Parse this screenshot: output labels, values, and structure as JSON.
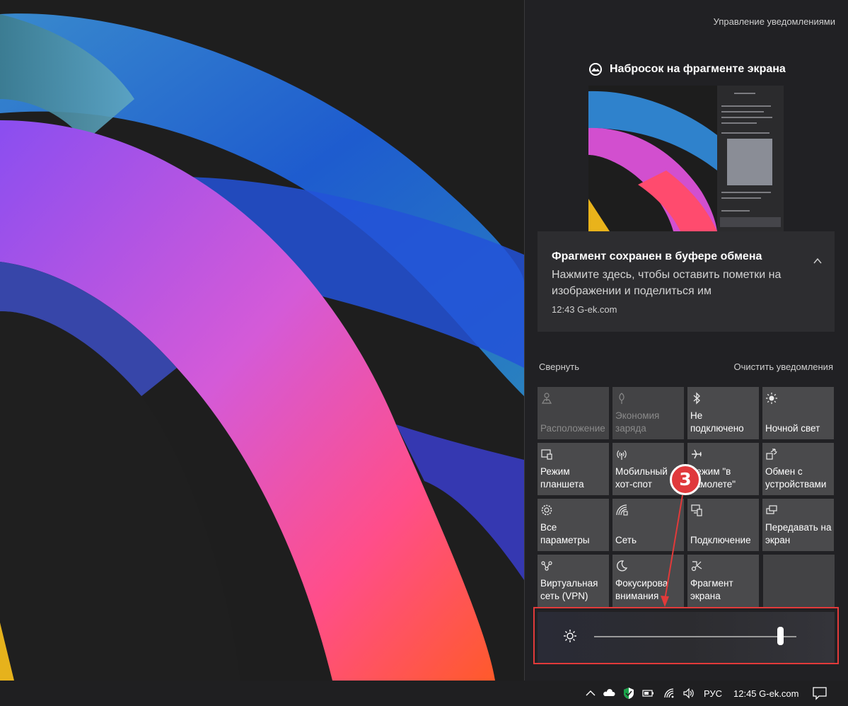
{
  "action_center": {
    "manage_link": "Управление уведомлениями",
    "app_name": "Набросок на фрагменте экрана",
    "notification": {
      "title": "Фрагмент сохранен в буфере обмена",
      "body": "Нажмите здесь, чтобы оставить пометки на изображении и поделиться им",
      "meta": "12:43 G-ek.com"
    },
    "collapse_link": "Свернуть",
    "clear_link": "Очистить уведомления",
    "tiles": [
      {
        "label": "Расположение",
        "icon": "location-icon",
        "dim": true
      },
      {
        "label": "Экономия\nзаряда",
        "icon": "battery-saver-icon",
        "dim": true
      },
      {
        "label": "Не\nподключено",
        "icon": "bluetooth-icon",
        "dim": false
      },
      {
        "label": "Ночной свет",
        "icon": "night-light-icon",
        "dim": false
      },
      {
        "label": "Режим\nпланшета",
        "icon": "tablet-mode-icon",
        "dim": false
      },
      {
        "label": "Мобильный\nхот-спот",
        "icon": "hotspot-icon",
        "dim": false
      },
      {
        "label": "Режим \"в\nсамолете\"",
        "icon": "airplane-icon",
        "dim": false
      },
      {
        "label": "Обмен с\nустройствами",
        "icon": "nearby-share-icon",
        "dim": false
      },
      {
        "label": "Все параметры",
        "icon": "settings-icon",
        "dim": false
      },
      {
        "label": "Сеть",
        "icon": "network-icon",
        "dim": false
      },
      {
        "label": "Подключение",
        "icon": "connect-icon",
        "dim": false
      },
      {
        "label": "Передавать на\nэкран",
        "icon": "project-icon",
        "dim": false
      },
      {
        "label": "Виртуальная\nсеть (VPN)",
        "icon": "vpn-icon",
        "dim": false
      },
      {
        "label": "Фокусирова\nвнимания",
        "icon": "focus-assist-icon",
        "dim": false
      },
      {
        "label": "Фрагмент\nэкрана",
        "icon": "screen-snip-icon",
        "dim": false
      }
    ],
    "brightness": 0.92
  },
  "annotation": {
    "badge": "3",
    "color": "#e23a3a"
  },
  "taskbar": {
    "language": "РУС",
    "clock": "12:45 G-ek.com"
  }
}
